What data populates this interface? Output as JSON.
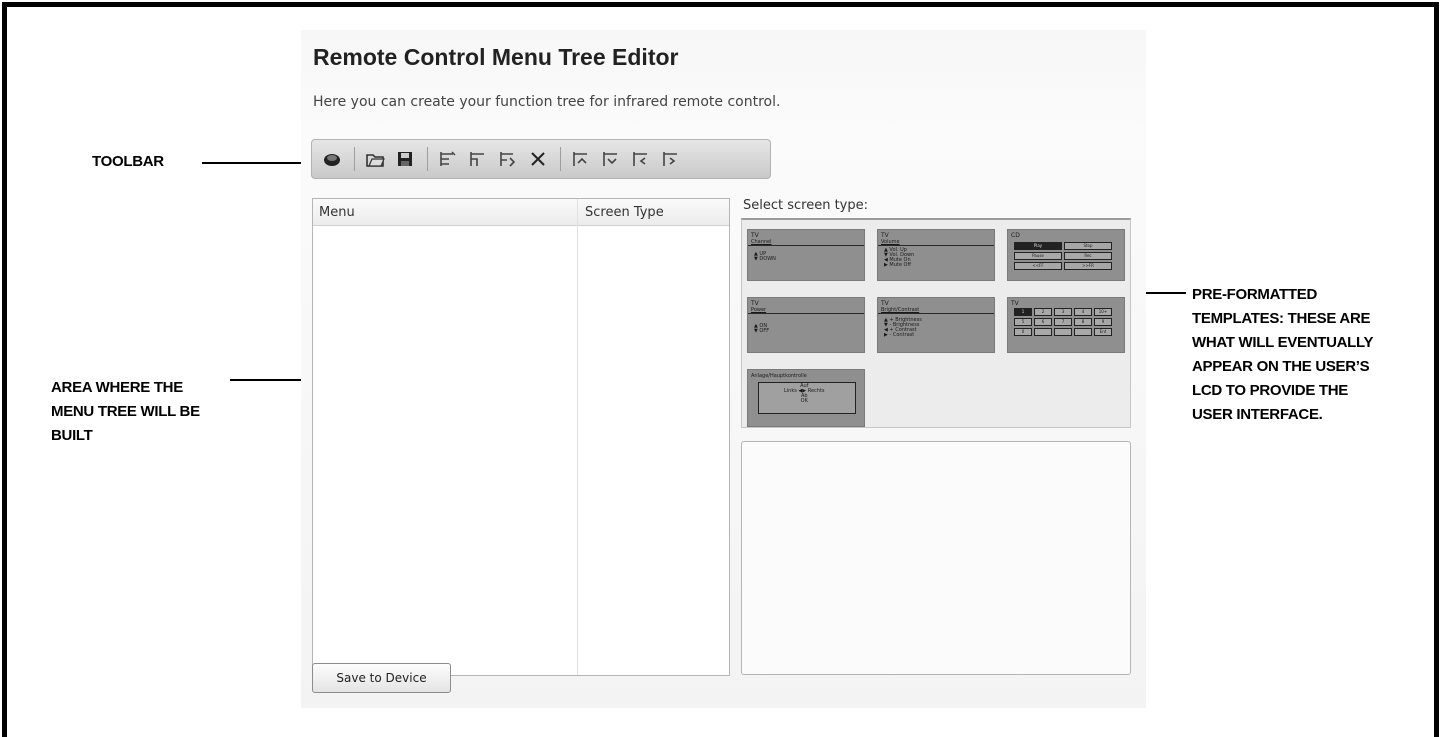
{
  "app": {
    "title": "Remote Control Menu Tree Editor",
    "subtitle": "Here you can create your function tree for infrared remote control."
  },
  "toolbar": {
    "buttons": [
      "new-icon",
      "open-folder-icon",
      "save-disk-icon",
      "insert-menu-icon",
      "insert-submenu-icon",
      "insert-item-icon",
      "delete-icon",
      "move-up-icon",
      "move-down-icon",
      "move-left-icon",
      "move-right-icon"
    ]
  },
  "menu_tree": {
    "columns": [
      "Menu",
      "Screen Type"
    ]
  },
  "templates": {
    "label": "Select screen type:",
    "items": [
      {
        "title": "TV",
        "subtitle": "Channel",
        "lines": "▲ UP\n▼ DOWN"
      },
      {
        "title": "TV",
        "subtitle": "Volume",
        "lines": "▲ Vol. Up\n▼ Vol. Down\n◀ Mute On\n▶ Mute Off"
      },
      {
        "title": "CD",
        "subtitle": "",
        "buttons": [
          "Play",
          "Stop",
          "Pause",
          "Rec",
          "<<FF",
          ">>FR"
        ]
      },
      {
        "title": "TV",
        "subtitle": "Power",
        "lines": "▲ ON\n▼ OFF"
      },
      {
        "title": "TV",
        "subtitle": "Bright/Contrast",
        "lines": "▲ + Brightness\n▼ - Brightness\n◀ + Contrast\n▶ - Contrast"
      },
      {
        "title": "TV",
        "subtitle": "",
        "buttons": [
          "1",
          "2",
          "3",
          "4",
          "10+",
          "5",
          "6",
          "7",
          "8",
          "9",
          "0",
          "",
          "",
          "",
          "Ent"
        ]
      },
      {
        "title": "Anlage/Hauptkontrolle",
        "subtitle": "",
        "lines": "Auf\nLinks ◀▶ Rechts\nAb\nOK"
      }
    ]
  },
  "actions": {
    "save_label": "Save to Device"
  },
  "callouts": {
    "toolbar": "TOOLBAR",
    "templates": [
      "PRE-FORMATTED",
      "TEMPLATES: THESE ARE",
      "WHAT WILL EVENTUALLY",
      "APPEAR ON THE USER’S",
      "LCD TO PROVIDE THE",
      "USER INTERFACE."
    ],
    "tree_area": [
      "AREA WHERE THE",
      "MENU TREE WILL BE",
      "BUILT"
    ]
  }
}
